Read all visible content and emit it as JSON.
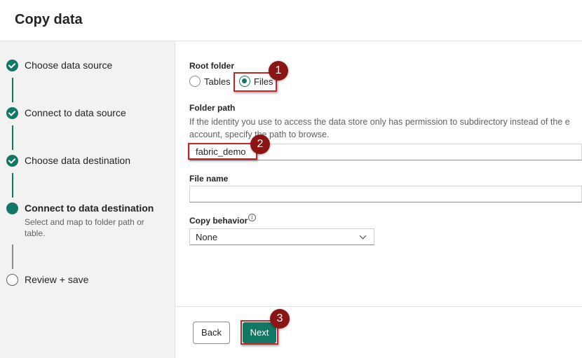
{
  "header": {
    "title": "Copy data"
  },
  "steps": [
    {
      "label": "Choose data source",
      "state": "done"
    },
    {
      "label": "Connect to data source",
      "state": "done"
    },
    {
      "label": "Choose data destination",
      "state": "done"
    },
    {
      "label": "Connect to data destination",
      "state": "current",
      "description": "Select and map to folder path or table."
    },
    {
      "label": "Review + save",
      "state": "pending"
    }
  ],
  "form": {
    "root_folder_label": "Root folder",
    "root_folder_options": [
      "Tables",
      "Files"
    ],
    "root_folder_selected": "Files",
    "folder_path_label": "Folder path",
    "folder_path_description_line1": "If the identity you use to access the data store only has permission to subdirectory instead of the e",
    "folder_path_description_line2": "account, specify the path to browse.",
    "folder_path_value": "fabric_demo",
    "file_name_label": "File name",
    "file_name_value": "",
    "copy_behavior_label": "Copy behavior",
    "copy_behavior_value": "None"
  },
  "footer": {
    "back_label": "Back",
    "next_label": "Next"
  },
  "callouts": [
    "1",
    "2",
    "3"
  ],
  "colors": {
    "accent": "#117865",
    "callout": "#8b1414",
    "highlight": "#c4262e"
  }
}
